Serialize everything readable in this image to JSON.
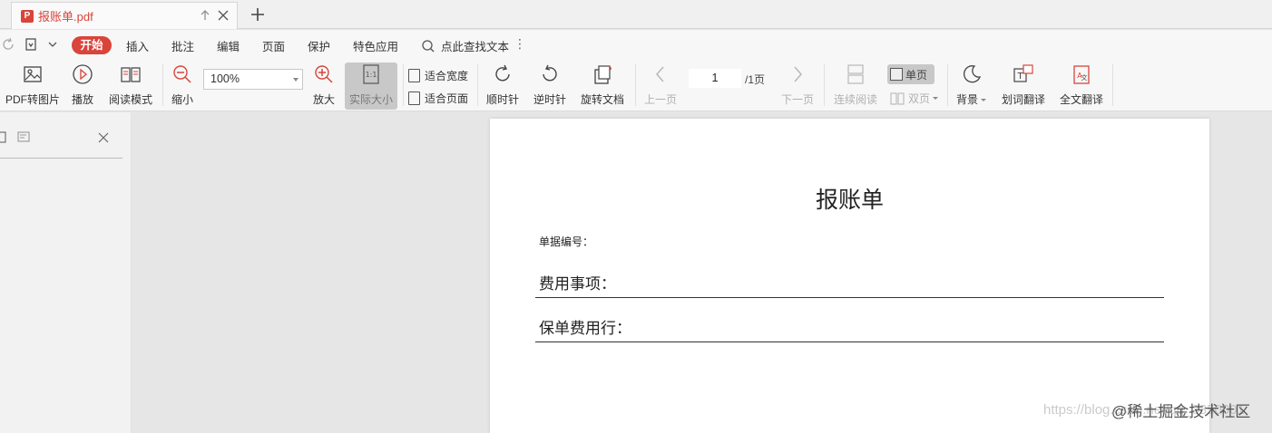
{
  "tab": {
    "title": "报账单.pdf",
    "icon": "pdf-file-icon"
  },
  "menu": {
    "items": [
      "开始",
      "插入",
      "批注",
      "编辑",
      "页面",
      "保护",
      "特色应用"
    ],
    "search": "点此查找文本",
    "more": "⋮"
  },
  "ribbon": {
    "pdf_to_image": "PDF转图片",
    "play": "播放",
    "reading_mode": "阅读模式",
    "zoom_out": "缩小",
    "zoom_value": "100%",
    "zoom_in": "放大",
    "actual_size": "实际大小",
    "fit_width": "适合宽度",
    "fit_page": "适合页面",
    "clockwise": "顺时针",
    "counterclockwise": "逆时针",
    "rotate_doc": "旋转文档",
    "prev_page": "上一页",
    "page_current": "1",
    "page_total": "/1页",
    "next_page": "下一页",
    "continuous": "连续阅读",
    "single_page": "单页",
    "double_page": "双页",
    "background": "背景",
    "word_translate": "划词翻译",
    "full_translate": "全文翻译"
  },
  "document": {
    "title": "报账单",
    "number_label": "单据编号：",
    "field1": "费用事项：",
    "field2": "保单费用行："
  },
  "overlay": {
    "watermark": "https://blog.csdn.net/qq_3850001",
    "brand": "@稀土掘金技术社区"
  },
  "colors": {
    "accent": "#d9443b"
  }
}
